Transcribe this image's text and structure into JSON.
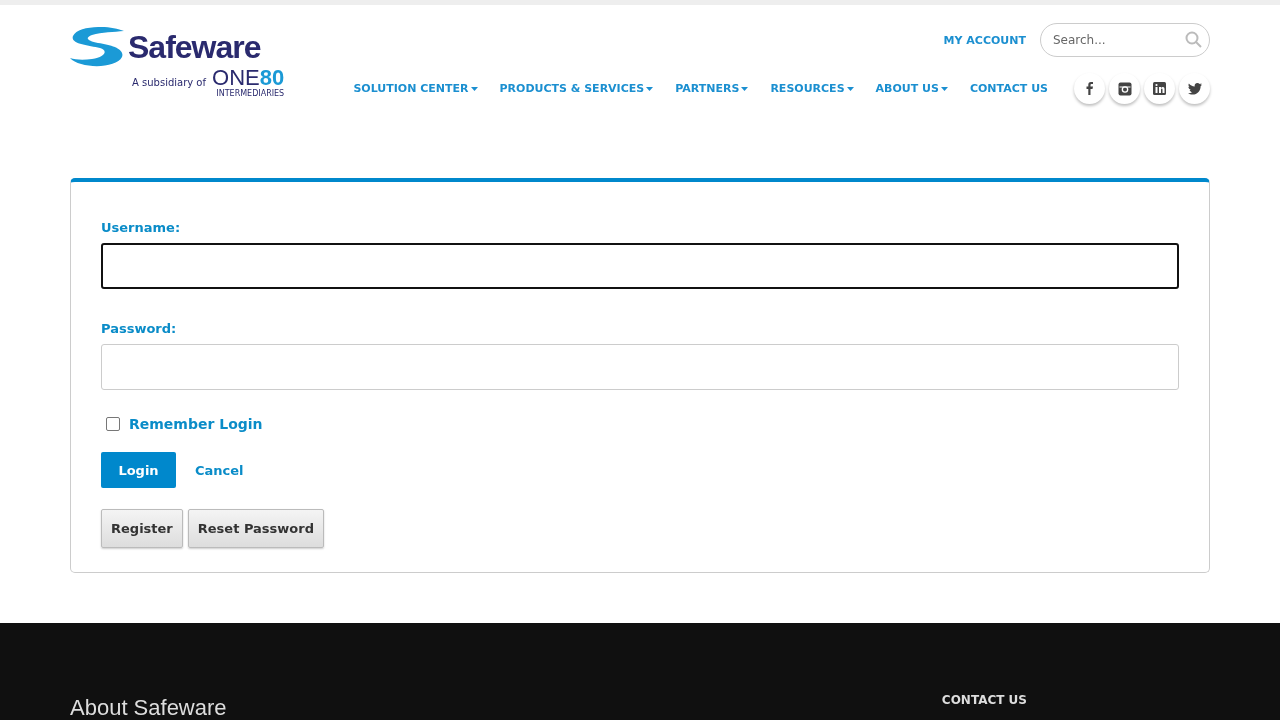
{
  "logo": {
    "wordmark": "Safeware",
    "tagline": "A subsidiary of",
    "parent_name": "ONE",
    "parent_number": "80",
    "parent_sub": "INTERMEDIARIES"
  },
  "top_links": [
    {
      "label": "MY ACCOUNT"
    }
  ],
  "search": {
    "placeholder": "Search..."
  },
  "nav": [
    {
      "label": "SOLUTION CENTER",
      "dropdown": true
    },
    {
      "label": "PRODUCTS & SERVICES",
      "dropdown": true
    },
    {
      "label": "PARTNERS",
      "dropdown": true
    },
    {
      "label": "RESOURCES",
      "dropdown": true
    },
    {
      "label": "ABOUT US",
      "dropdown": true
    },
    {
      "label": "CONTACT US",
      "dropdown": false
    }
  ],
  "social": [
    {
      "kind": "facebook"
    },
    {
      "kind": "instagram"
    },
    {
      "kind": "linkedin"
    },
    {
      "kind": "twitter"
    }
  ],
  "form": {
    "fields": [
      {
        "label": "Username:",
        "focused": true
      },
      {
        "label": "Password:",
        "focused": false
      }
    ],
    "remember": {
      "label": "Remember Login",
      "checked": false
    },
    "login_button": "Login",
    "cancel_link": "Cancel",
    "secondary_buttons": [
      "Register",
      "Reset Password"
    ]
  },
  "footer": {
    "heading": "About Safeware",
    "contact_heading": "CONTACT US"
  }
}
